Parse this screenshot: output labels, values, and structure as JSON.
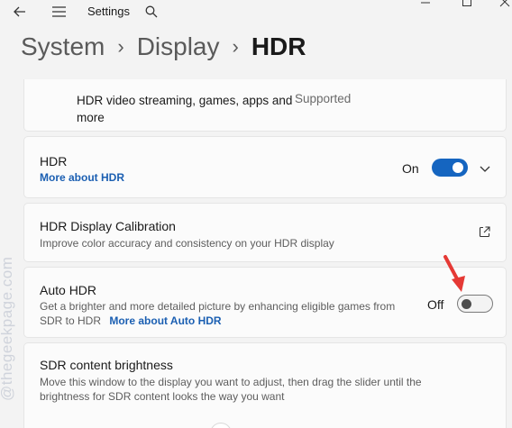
{
  "titlebar": {
    "app_title": "Settings",
    "back_icon": "back-arrow-icon",
    "menu_icon": "hamburger-menu-icon",
    "search_icon": "search-icon"
  },
  "breadcrumb": {
    "level1": "System",
    "level2": "Display",
    "current": "HDR",
    "separator": "›"
  },
  "hdr_support": {
    "label": "HDR video streaming, games, apps and more",
    "status": "Supported"
  },
  "hdr": {
    "title": "HDR",
    "link": "More about HDR",
    "state": "On",
    "enabled": true
  },
  "calibration": {
    "title": "HDR Display Calibration",
    "desc": "Improve color accuracy and consistency on your HDR display",
    "icon": "open-external-icon"
  },
  "auto_hdr": {
    "title": "Auto HDR",
    "desc": "Get a brighter and more detailed picture by enhancing eligible games from SDR to HDR",
    "link": "More about Auto HDR",
    "state": "Off",
    "enabled": false
  },
  "sdr": {
    "title": "SDR content brightness",
    "desc": "Move this window to the display you want to adjust, then drag the slider until the brightness for SDR content looks the way you want"
  },
  "colors": {
    "accent": "#1565c0",
    "link": "#1b5fb2",
    "annotation_arrow": "#e53935"
  },
  "watermark": "@thegeekpage.com"
}
